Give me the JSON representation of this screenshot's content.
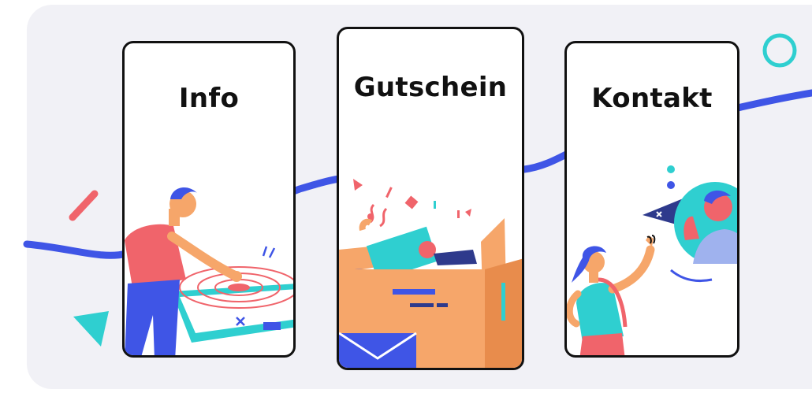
{
  "cards": [
    {
      "title": "Info",
      "illustration": "person-touching-table"
    },
    {
      "title": "Gutschein",
      "illustration": "gift-box-confetti"
    },
    {
      "title": "Kontakt",
      "illustration": "person-video-call"
    }
  ],
  "colors": {
    "background_panel": "#f1f1f6",
    "card_border": "#111111",
    "line_blue": "#3f55e6",
    "coral": "#f0646b",
    "teal": "#2fcfd0",
    "orange": "#f6a66a",
    "navy": "#2e3a8c"
  }
}
